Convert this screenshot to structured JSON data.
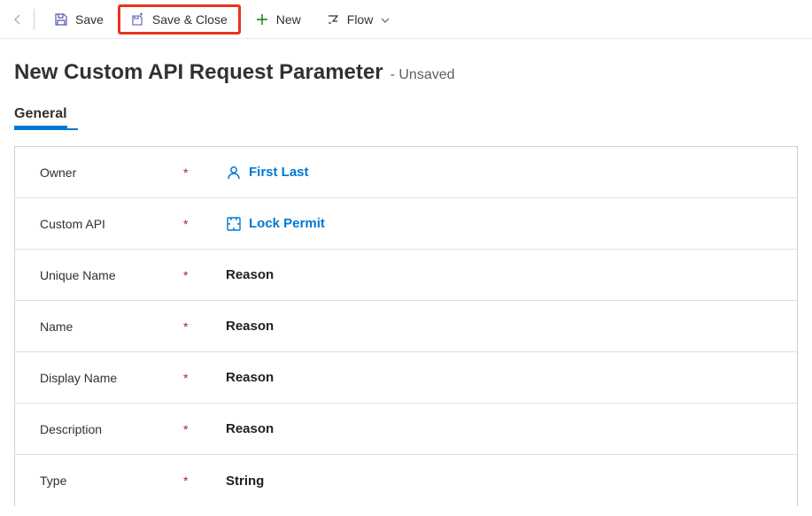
{
  "toolbar": {
    "save_label": "Save",
    "save_close_label": "Save & Close",
    "new_label": "New",
    "flow_label": "Flow"
  },
  "header": {
    "title": "New Custom API Request Parameter",
    "status_prefix": "- ",
    "status": "Unsaved"
  },
  "tabs": {
    "general": "General"
  },
  "form": {
    "owner": {
      "label": "Owner",
      "value": "First Last"
    },
    "custom_api": {
      "label": "Custom API",
      "value": "Lock Permit"
    },
    "unique_name": {
      "label": "Unique Name",
      "value": "Reason"
    },
    "name": {
      "label": "Name",
      "value": "Reason"
    },
    "display_name": {
      "label": "Display Name",
      "value": "Reason"
    },
    "description": {
      "label": "Description",
      "value": "Reason"
    },
    "type": {
      "label": "Type",
      "value": "String"
    }
  }
}
